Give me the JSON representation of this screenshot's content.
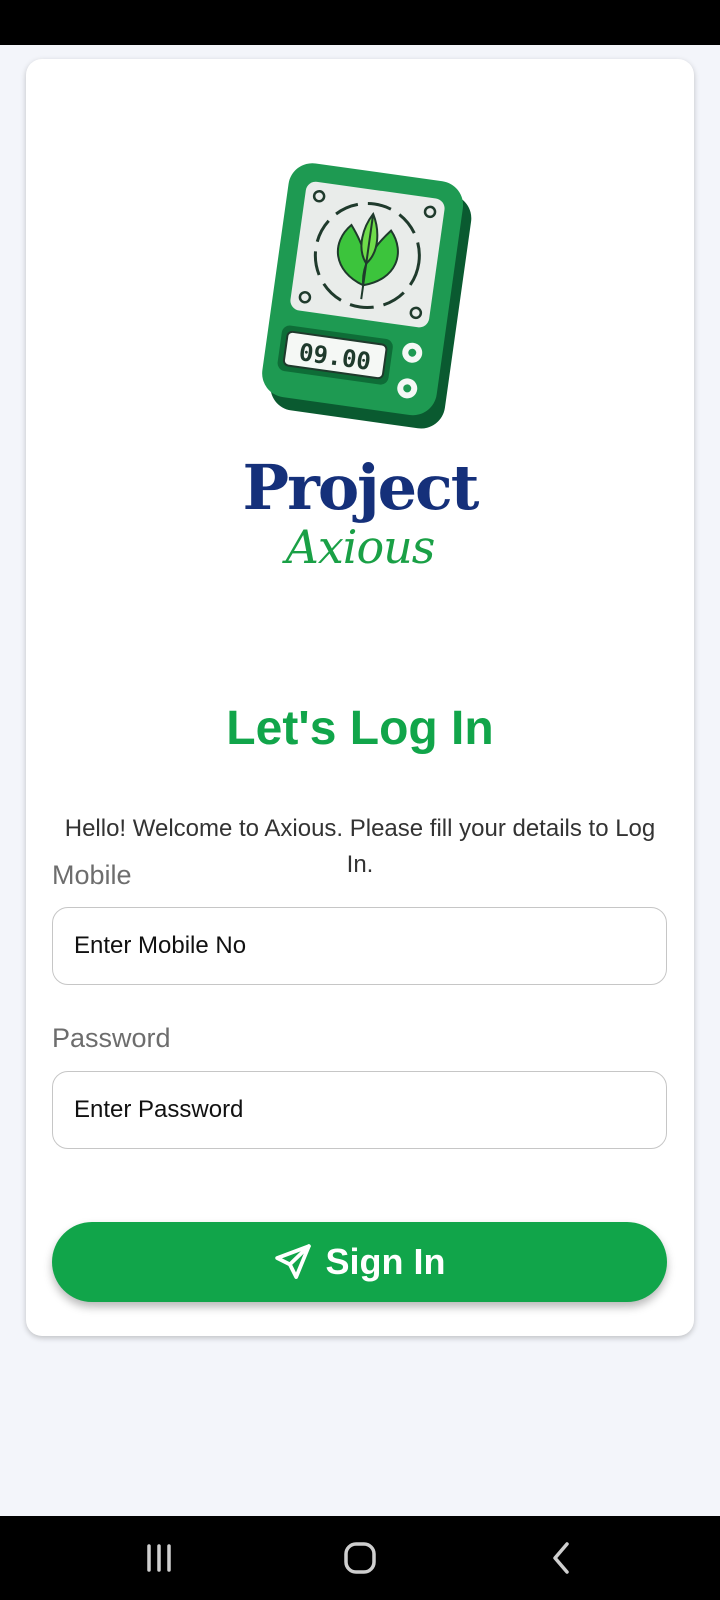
{
  "brand": {
    "title_line1": "Project",
    "title_line2": "Axious",
    "device_display": "09.00"
  },
  "login": {
    "heading": "Let's Log In",
    "subtitle": "Hello! Welcome to Axious. Please fill your details to Log In."
  },
  "form": {
    "mobile_label": "Mobile",
    "mobile_placeholder": "Enter Mobile No",
    "password_label": "Password",
    "password_placeholder": "Enter Password",
    "submit_label": "Sign In",
    "submit_icon": "paper-plane-icon"
  },
  "navigation": {
    "buttons": [
      "recent-apps-icon",
      "home-icon",
      "back-icon"
    ]
  },
  "colors": {
    "accent_green": "#11a54a",
    "brand_navy": "#15307a",
    "page_background": "#f3f5fa"
  }
}
